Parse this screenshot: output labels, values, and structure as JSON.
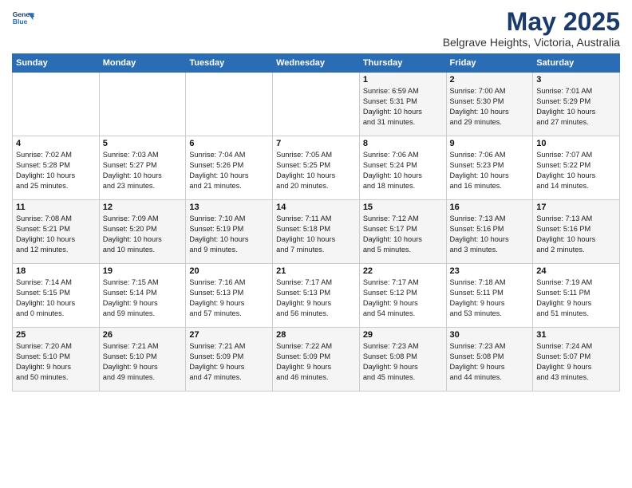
{
  "header": {
    "logo_line1": "General",
    "logo_line2": "Blue",
    "title": "May 2025",
    "subtitle": "Belgrave Heights, Victoria, Australia"
  },
  "days_of_week": [
    "Sunday",
    "Monday",
    "Tuesday",
    "Wednesday",
    "Thursday",
    "Friday",
    "Saturday"
  ],
  "weeks": [
    [
      {
        "num": "",
        "info": ""
      },
      {
        "num": "",
        "info": ""
      },
      {
        "num": "",
        "info": ""
      },
      {
        "num": "",
        "info": ""
      },
      {
        "num": "1",
        "info": "Sunrise: 6:59 AM\nSunset: 5:31 PM\nDaylight: 10 hours\nand 31 minutes."
      },
      {
        "num": "2",
        "info": "Sunrise: 7:00 AM\nSunset: 5:30 PM\nDaylight: 10 hours\nand 29 minutes."
      },
      {
        "num": "3",
        "info": "Sunrise: 7:01 AM\nSunset: 5:29 PM\nDaylight: 10 hours\nand 27 minutes."
      }
    ],
    [
      {
        "num": "4",
        "info": "Sunrise: 7:02 AM\nSunset: 5:28 PM\nDaylight: 10 hours\nand 25 minutes."
      },
      {
        "num": "5",
        "info": "Sunrise: 7:03 AM\nSunset: 5:27 PM\nDaylight: 10 hours\nand 23 minutes."
      },
      {
        "num": "6",
        "info": "Sunrise: 7:04 AM\nSunset: 5:26 PM\nDaylight: 10 hours\nand 21 minutes."
      },
      {
        "num": "7",
        "info": "Sunrise: 7:05 AM\nSunset: 5:25 PM\nDaylight: 10 hours\nand 20 minutes."
      },
      {
        "num": "8",
        "info": "Sunrise: 7:06 AM\nSunset: 5:24 PM\nDaylight: 10 hours\nand 18 minutes."
      },
      {
        "num": "9",
        "info": "Sunrise: 7:06 AM\nSunset: 5:23 PM\nDaylight: 10 hours\nand 16 minutes."
      },
      {
        "num": "10",
        "info": "Sunrise: 7:07 AM\nSunset: 5:22 PM\nDaylight: 10 hours\nand 14 minutes."
      }
    ],
    [
      {
        "num": "11",
        "info": "Sunrise: 7:08 AM\nSunset: 5:21 PM\nDaylight: 10 hours\nand 12 minutes."
      },
      {
        "num": "12",
        "info": "Sunrise: 7:09 AM\nSunset: 5:20 PM\nDaylight: 10 hours\nand 10 minutes."
      },
      {
        "num": "13",
        "info": "Sunrise: 7:10 AM\nSunset: 5:19 PM\nDaylight: 10 hours\nand 9 minutes."
      },
      {
        "num": "14",
        "info": "Sunrise: 7:11 AM\nSunset: 5:18 PM\nDaylight: 10 hours\nand 7 minutes."
      },
      {
        "num": "15",
        "info": "Sunrise: 7:12 AM\nSunset: 5:17 PM\nDaylight: 10 hours\nand 5 minutes."
      },
      {
        "num": "16",
        "info": "Sunrise: 7:13 AM\nSunset: 5:16 PM\nDaylight: 10 hours\nand 3 minutes."
      },
      {
        "num": "17",
        "info": "Sunrise: 7:13 AM\nSunset: 5:16 PM\nDaylight: 10 hours\nand 2 minutes."
      }
    ],
    [
      {
        "num": "18",
        "info": "Sunrise: 7:14 AM\nSunset: 5:15 PM\nDaylight: 10 hours\nand 0 minutes."
      },
      {
        "num": "19",
        "info": "Sunrise: 7:15 AM\nSunset: 5:14 PM\nDaylight: 9 hours\nand 59 minutes."
      },
      {
        "num": "20",
        "info": "Sunrise: 7:16 AM\nSunset: 5:13 PM\nDaylight: 9 hours\nand 57 minutes."
      },
      {
        "num": "21",
        "info": "Sunrise: 7:17 AM\nSunset: 5:13 PM\nDaylight: 9 hours\nand 56 minutes."
      },
      {
        "num": "22",
        "info": "Sunrise: 7:17 AM\nSunset: 5:12 PM\nDaylight: 9 hours\nand 54 minutes."
      },
      {
        "num": "23",
        "info": "Sunrise: 7:18 AM\nSunset: 5:11 PM\nDaylight: 9 hours\nand 53 minutes."
      },
      {
        "num": "24",
        "info": "Sunrise: 7:19 AM\nSunset: 5:11 PM\nDaylight: 9 hours\nand 51 minutes."
      }
    ],
    [
      {
        "num": "25",
        "info": "Sunrise: 7:20 AM\nSunset: 5:10 PM\nDaylight: 9 hours\nand 50 minutes."
      },
      {
        "num": "26",
        "info": "Sunrise: 7:21 AM\nSunset: 5:10 PM\nDaylight: 9 hours\nand 49 minutes."
      },
      {
        "num": "27",
        "info": "Sunrise: 7:21 AM\nSunset: 5:09 PM\nDaylight: 9 hours\nand 47 minutes."
      },
      {
        "num": "28",
        "info": "Sunrise: 7:22 AM\nSunset: 5:09 PM\nDaylight: 9 hours\nand 46 minutes."
      },
      {
        "num": "29",
        "info": "Sunrise: 7:23 AM\nSunset: 5:08 PM\nDaylight: 9 hours\nand 45 minutes."
      },
      {
        "num": "30",
        "info": "Sunrise: 7:23 AM\nSunset: 5:08 PM\nDaylight: 9 hours\nand 44 minutes."
      },
      {
        "num": "31",
        "info": "Sunrise: 7:24 AM\nSunset: 5:07 PM\nDaylight: 9 hours\nand 43 minutes."
      }
    ]
  ]
}
